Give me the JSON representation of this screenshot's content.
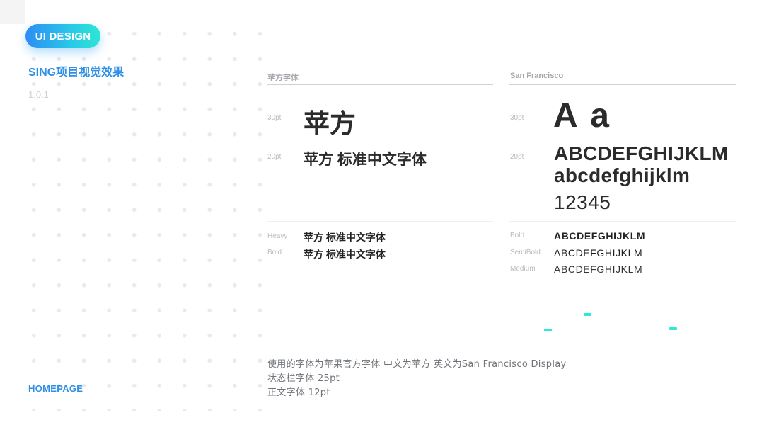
{
  "sidebar": {
    "badge_label": "UI DESIGN",
    "project_title": "SING项目视觉效果",
    "version": "1.0.1",
    "homepage_label": "HOMEPAGE"
  },
  "pingfang": {
    "title": "苹方字体",
    "label_30": "30pt",
    "sample_30": "苹方",
    "label_20": "20pt",
    "sample_20": "苹方 标准中文字体",
    "weights": [
      {
        "name": "Heavy",
        "sample": "苹方 标准中文字体"
      },
      {
        "name": "Bold",
        "sample": "苹方 标准中文字体"
      }
    ]
  },
  "sanfrancisco": {
    "title": "San Francisco",
    "label_30": "30pt",
    "sample_30": "A a",
    "label_20": "20pt",
    "sample_upper": "ABCDEFGHIJKLM",
    "sample_lower": "abcdefghijklm",
    "sample_digits": "12345",
    "weights": [
      {
        "name": "Bold",
        "sample": "ABCDEFGHIJKLM"
      },
      {
        "name": "SemiBold",
        "sample": "ABCDEFGHIJKLM"
      },
      {
        "name": "Medium",
        "sample": "ABCDEFGHIJKLM"
      }
    ]
  },
  "notes": [
    "使用的字体为苹果官方字体 中文为苹方 英文为San Francisco Display",
    "状态栏字体 25pt",
    "正文字体 12pt"
  ],
  "colors": {
    "accent_blue": "#2d8fe6",
    "accent_cyan": "#2ee9d6"
  }
}
